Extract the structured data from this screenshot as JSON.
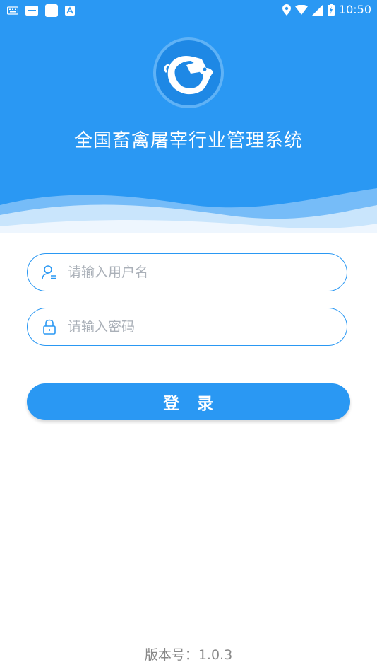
{
  "status_bar": {
    "time": "10:50",
    "left_icons": [
      "keyboard-icon",
      "hms-icon",
      "square-icon",
      "a-icon"
    ],
    "right_icons": [
      "location-icon",
      "wifi-icon",
      "signal-icon",
      "battery-icon"
    ]
  },
  "header": {
    "title": "全国畜禽屠宰行业管理系统",
    "logo_icon": "pig-logo-icon",
    "background_color": "#2a98f3"
  },
  "form": {
    "username_placeholder": "请输入用户名",
    "username_value": "",
    "password_placeholder": "请输入密码",
    "password_value": "",
    "login_label": "登　录"
  },
  "footer": {
    "version": "版本号：1.0.3"
  },
  "colors": {
    "accent": "#2a98f3",
    "placeholder": "#aab0b8",
    "version_text": "#888888"
  }
}
